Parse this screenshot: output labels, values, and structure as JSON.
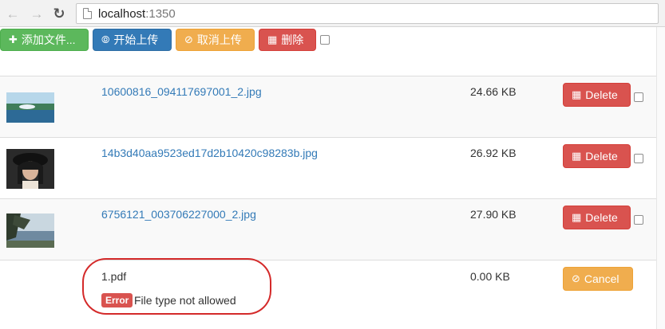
{
  "browser": {
    "url_host": "localhost",
    "url_port": ":1350",
    "back_icon": "arrow-left-icon",
    "forward_icon": "arrow-right-icon",
    "reload_icon": "reload-icon",
    "page_icon": "page-icon"
  },
  "toolbar": {
    "add_files": "添加文件...",
    "start_upload": "开始上传",
    "cancel_upload": "取消上传",
    "delete": "删除"
  },
  "colors": {
    "green": "#5cb85c",
    "blue": "#337ab7",
    "orange": "#f0ad4e",
    "red": "#d9534f",
    "link": "#337ab7",
    "highlight": "#d42a2a"
  },
  "files": [
    {
      "name": "10600816_094117697001_2.jpg",
      "size": "24.66 KB",
      "action": "Delete",
      "thumb": "lake-landscape"
    },
    {
      "name": "14b3d40aa9523ed17d2b10420c98283b.jpg",
      "size": "26.92 KB",
      "action": "Delete",
      "thumb": "portrait-with-hat"
    },
    {
      "name": "6756121_003706227000_2.jpg",
      "size": "27.90 KB",
      "action": "Delete",
      "thumb": "lakeside-trees"
    },
    {
      "name": "1.pdf",
      "size": "0.00 KB",
      "action": "Cancel",
      "error_label": "Error",
      "error_message": "File type not allowed"
    }
  ]
}
